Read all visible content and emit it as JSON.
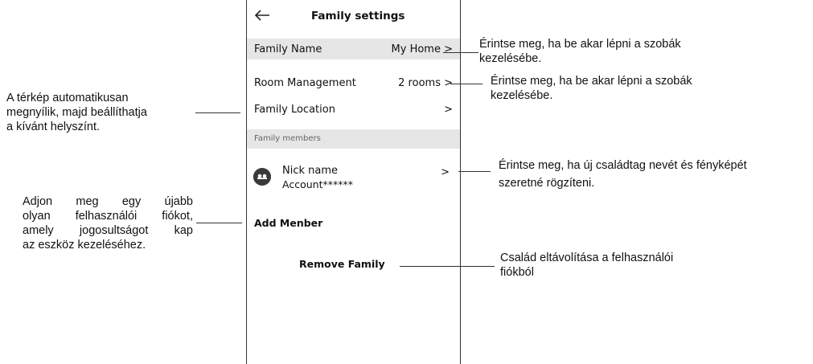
{
  "app": {
    "title": "Family settings"
  },
  "rows": {
    "family_name": {
      "label": "Family Name",
      "value": "My Home >"
    },
    "room_management": {
      "label": "Room Management",
      "value": "2 rooms >"
    },
    "family_location": {
      "label": "Family Location",
      "value": ">"
    }
  },
  "members_section": {
    "label": "Family members"
  },
  "member": {
    "name": "Nick name",
    "account": "Account******",
    "arrow": ">"
  },
  "actions": {
    "add_member": "Add Menber",
    "remove_family": "Remove Family"
  },
  "annotations": {
    "family_name_note": "Érintse meg, ha be akar lépni a szobák kezelésébe.",
    "room_note": "Érintse meg, ha be akar lépni a szobák kezelésébe.",
    "location_note_l1": "A térkép automatikusan",
    "location_note_l2": "megnyílik, majd beállíthatja",
    "location_note_l3": "a kívánt helyszínt.",
    "member_note_l1": "Érintse meg, ha új családtag nevét és fényképét",
    "member_note_l2": "szeretné rögzíteni.",
    "add_note_l1": "Adjon meg egy újabb",
    "add_note_l2": "olyan felhasználói fiókot,",
    "add_note_l3": "amely jogosultságot kap",
    "add_note_l4": "az eszköz kezeléséhez.",
    "remove_note_l1": "Család eltávolítása a felhasználói",
    "remove_note_l2": "fiókból"
  },
  "colors": {
    "row_highlight": "#e6e6e6",
    "frame": "#333333"
  }
}
